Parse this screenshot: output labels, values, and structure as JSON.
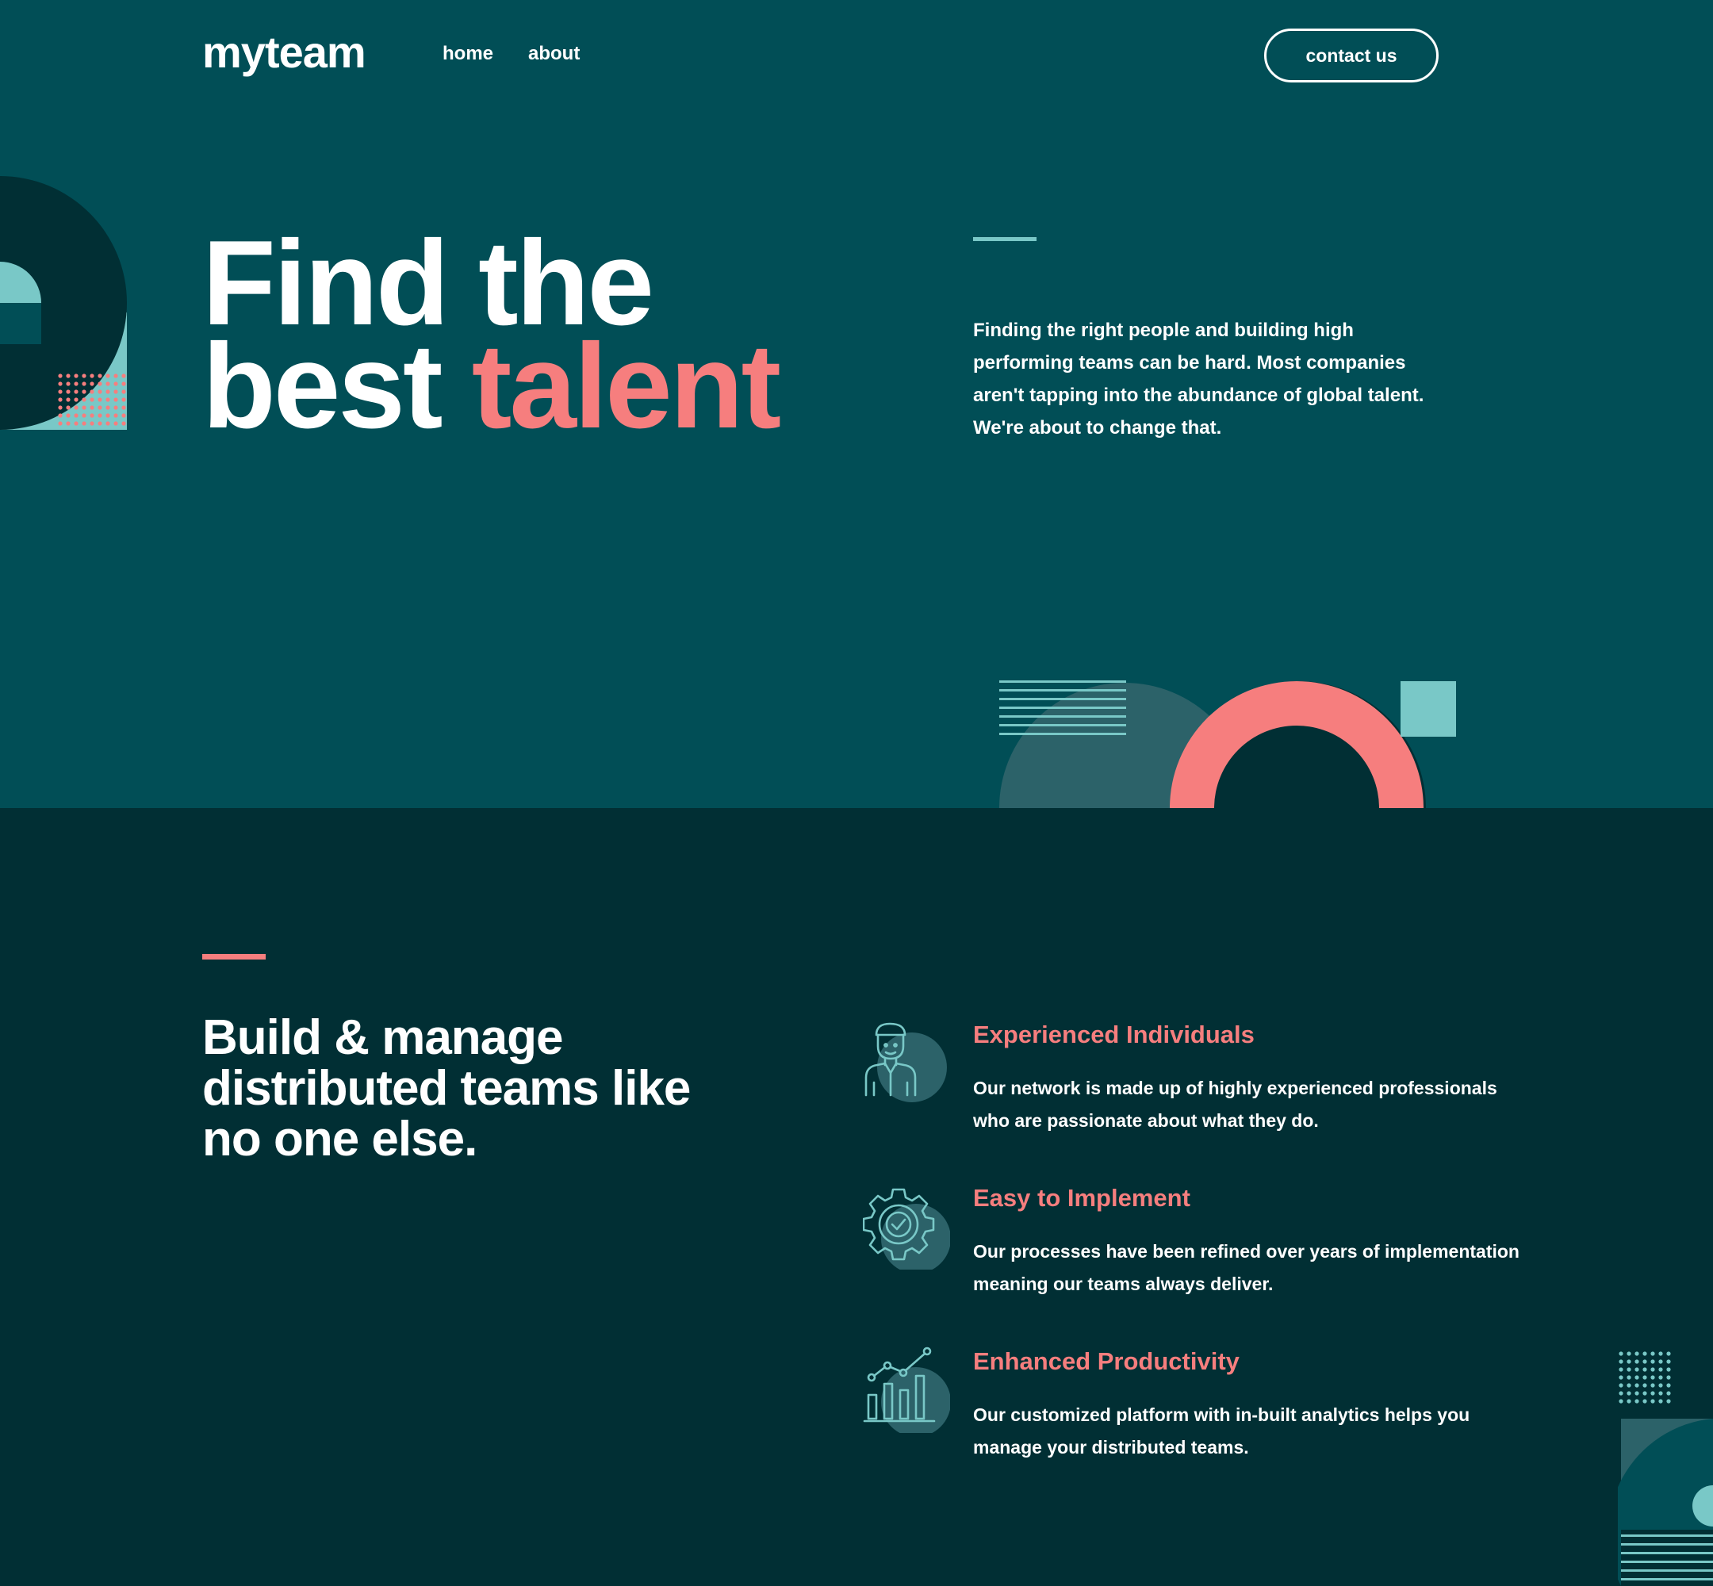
{
  "header": {
    "logo": "myteam",
    "nav": [
      {
        "label": "home"
      },
      {
        "label": "about"
      }
    ],
    "contact_button": "contact us"
  },
  "hero": {
    "title_line1": "Find the",
    "title_line2_plain": "best ",
    "title_line2_accent": "talent",
    "description": "Finding the right people and building high performing teams can be hard. Most companies aren't tapping into the abundance of global talent. We're about to change that."
  },
  "features": {
    "title": "Build & manage distributed teams like no one else.",
    "items": [
      {
        "icon": "person-icon",
        "title": "Experienced Individuals",
        "text": "Our network is made up of highly experienced professionals who are passionate about what they do."
      },
      {
        "icon": "gear-check-icon",
        "title": "Easy to Implement",
        "text": "Our processes have been refined over years of implementation meaning our teams always deliver."
      },
      {
        "icon": "analytics-chart-icon",
        "title": "Enhanced Productivity",
        "text": "Our customized platform with in-built analytics helps you manage your distributed teams."
      }
    ]
  },
  "colors": {
    "hero_bg": "#014E56",
    "section_bg": "#012F34",
    "accent_coral": "#F67E7E",
    "accent_teal": "#79C8C7",
    "text": "#FFFFFF"
  }
}
